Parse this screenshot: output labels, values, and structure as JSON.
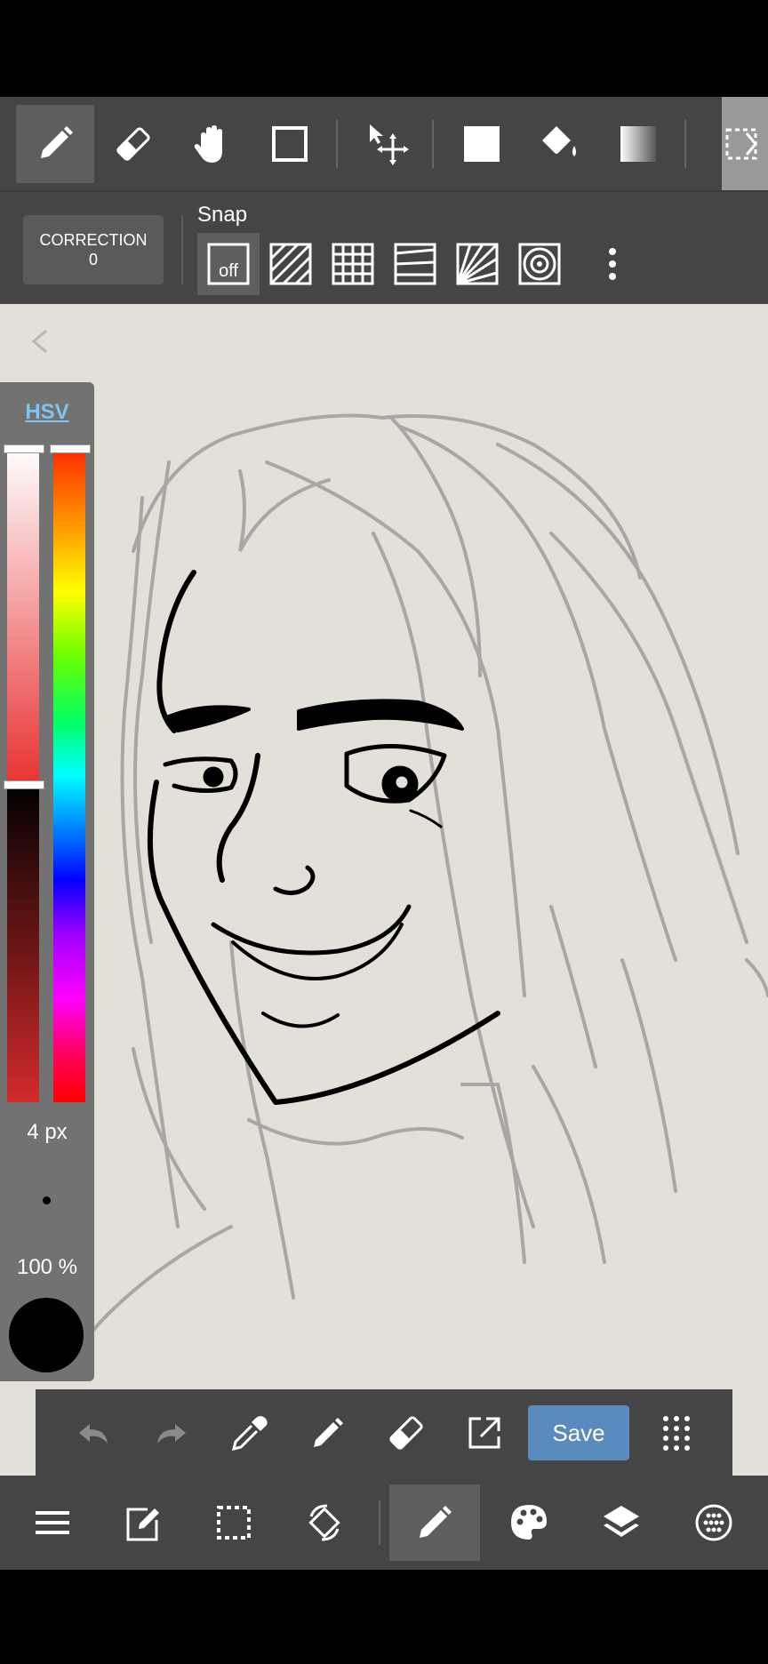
{
  "toolbar": {
    "tools": [
      "pen-tool",
      "eraser-tool",
      "hand-tool",
      "rectangle-tool",
      "move-tool",
      "fill-square-tool",
      "bucket-tool",
      "gradient-tool",
      "selection-tool"
    ],
    "active_tool": "pen-tool"
  },
  "snap": {
    "correction_label": "CORRECTION",
    "correction_value": "0",
    "label": "Snap",
    "off_label": "off",
    "active": "off"
  },
  "color_panel": {
    "mode_tab": "HSV",
    "size": "4 px",
    "opacity": "100 %",
    "current_color": "#000000"
  },
  "action_bar": {
    "save_label": "Save"
  },
  "bottom_nav": {
    "items": [
      "menu",
      "edit",
      "selection",
      "transform",
      "brush",
      "palette",
      "layers",
      "materials"
    ],
    "active": "brush"
  },
  "colors": {
    "toolbar_bg": "#454545",
    "active_bg": "#5e5e5e",
    "canvas_bg": "#e3e0d9",
    "save_button": "#5a8bbf",
    "hsv_tab": "#7fc3f0"
  }
}
